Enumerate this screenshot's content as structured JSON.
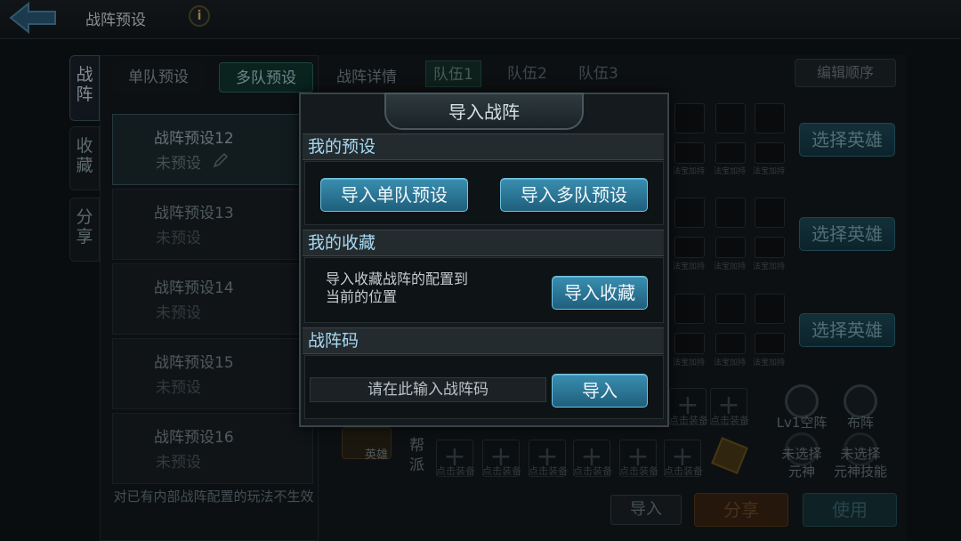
{
  "header": {
    "title": "战阵预设",
    "info_glyph": "i"
  },
  "side_tabs": [
    {
      "label": "战\n阵",
      "active": true
    },
    {
      "label": "收\n藏",
      "active": false
    },
    {
      "label": "分\n享",
      "active": false
    }
  ],
  "preset_tabs": {
    "single": "单队预设",
    "multi": "多队预设",
    "active": "multi"
  },
  "presets": [
    {
      "name": "战阵预设12",
      "status": "未预设",
      "selected": true
    },
    {
      "name": "战阵预设13",
      "status": "未预设",
      "selected": false
    },
    {
      "name": "战阵预设14",
      "status": "未预设",
      "selected": false
    },
    {
      "name": "战阵预设15",
      "status": "未预设",
      "selected": false
    },
    {
      "name": "战阵预设16",
      "status": "未预设",
      "selected": false
    }
  ],
  "left_note": "对已有内部战阵配置的玩法不生效",
  "detail": {
    "label": "战阵详情",
    "teams": [
      "队伍1",
      "队伍2",
      "队伍3"
    ],
    "active_team": "队伍1",
    "edit_order": "编辑顺序",
    "choose_hero": "选择英雄",
    "treasure_add": "法宝加持",
    "click_equip": "点击装备",
    "hero_label": "英雄",
    "sect_label": "帮\n派",
    "formation_level": "Lv1空阵",
    "formation": "布阵",
    "spirit_unselected": "未选择\n元神",
    "spirit_skill_unselected": "未选择\n元神技能"
  },
  "bottom_buttons": {
    "import": "导入",
    "share": "分享",
    "use": "使用"
  },
  "modal": {
    "title": "导入战阵",
    "my_presets": {
      "header": "我的预设",
      "import_single": "导入单队预设",
      "import_multi": "导入多队预设"
    },
    "my_favorites": {
      "header": "我的收藏",
      "description": "导入收藏战阵的配置到\n当前的位置",
      "import_favorites": "导入收藏"
    },
    "formation_code": {
      "header": "战阵码",
      "placeholder": "请在此输入战阵码",
      "import": "导入"
    }
  },
  "colors": {
    "accent_blue": "#3a8eb0",
    "header_text": "#a8d8f0",
    "share_orange": "#5a3a1c"
  }
}
